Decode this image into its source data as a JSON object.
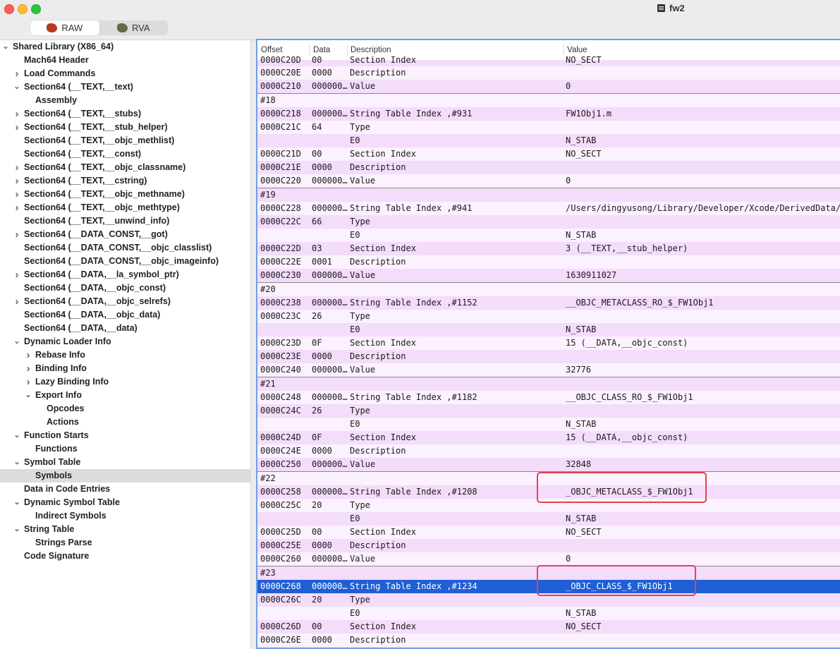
{
  "window": {
    "title": "fw2"
  },
  "toolbar": {
    "segments": [
      {
        "label": "RAW",
        "icon": "raw-icon",
        "active": true
      },
      {
        "label": "RVA",
        "icon": "rva-icon",
        "active": false
      }
    ]
  },
  "sidebar": {
    "items": [
      {
        "label": "Shared Library  (X86_64)",
        "level": 0,
        "chevron": "down"
      },
      {
        "label": "Mach64 Header",
        "level": 1,
        "chevron": ""
      },
      {
        "label": "Load Commands",
        "level": 1,
        "chevron": "right"
      },
      {
        "label": "Section64 (__TEXT,__text)",
        "level": 1,
        "chevron": "down"
      },
      {
        "label": "Assembly",
        "level": 2,
        "chevron": ""
      },
      {
        "label": "Section64 (__TEXT,__stubs)",
        "level": 1,
        "chevron": "right"
      },
      {
        "label": "Section64 (__TEXT,__stub_helper)",
        "level": 1,
        "chevron": "right"
      },
      {
        "label": "Section64 (__TEXT,__objc_methlist)",
        "level": 1,
        "chevron": ""
      },
      {
        "label": "Section64 (__TEXT,__const)",
        "level": 1,
        "chevron": ""
      },
      {
        "label": "Section64 (__TEXT,__objc_classname)",
        "level": 1,
        "chevron": "right"
      },
      {
        "label": "Section64 (__TEXT,__cstring)",
        "level": 1,
        "chevron": "right"
      },
      {
        "label": "Section64 (__TEXT,__objc_methname)",
        "level": 1,
        "chevron": "right"
      },
      {
        "label": "Section64 (__TEXT,__objc_methtype)",
        "level": 1,
        "chevron": "right"
      },
      {
        "label": "Section64 (__TEXT,__unwind_info)",
        "level": 1,
        "chevron": ""
      },
      {
        "label": "Section64 (__DATA_CONST,__got)",
        "level": 1,
        "chevron": "right"
      },
      {
        "label": "Section64 (__DATA_CONST,__objc_classlist)",
        "level": 1,
        "chevron": ""
      },
      {
        "label": "Section64 (__DATA_CONST,__objc_imageinfo)",
        "level": 1,
        "chevron": ""
      },
      {
        "label": "Section64 (__DATA,__la_symbol_ptr)",
        "level": 1,
        "chevron": "right"
      },
      {
        "label": "Section64 (__DATA,__objc_const)",
        "level": 1,
        "chevron": ""
      },
      {
        "label": "Section64 (__DATA,__objc_selrefs)",
        "level": 1,
        "chevron": "right"
      },
      {
        "label": "Section64 (__DATA,__objc_data)",
        "level": 1,
        "chevron": ""
      },
      {
        "label": "Section64 (__DATA,__data)",
        "level": 1,
        "chevron": ""
      },
      {
        "label": "Dynamic Loader Info",
        "level": 1,
        "chevron": "down"
      },
      {
        "label": "Rebase Info",
        "level": 2,
        "chevron": "right"
      },
      {
        "label": "Binding Info",
        "level": 2,
        "chevron": "right"
      },
      {
        "label": "Lazy Binding Info",
        "level": 2,
        "chevron": "right"
      },
      {
        "label": "Export Info",
        "level": 2,
        "chevron": "down"
      },
      {
        "label": "Opcodes",
        "level": 3,
        "chevron": ""
      },
      {
        "label": "Actions",
        "level": 3,
        "chevron": ""
      },
      {
        "label": "Function Starts",
        "level": 1,
        "chevron": "down"
      },
      {
        "label": "Functions",
        "level": 2,
        "chevron": ""
      },
      {
        "label": "Symbol Table",
        "level": 1,
        "chevron": "down"
      },
      {
        "label": "Symbols",
        "level": 2,
        "chevron": "",
        "selected": true
      },
      {
        "label": "Data in Code Entries",
        "level": 1,
        "chevron": ""
      },
      {
        "label": "Dynamic Symbol Table",
        "level": 1,
        "chevron": "down"
      },
      {
        "label": "Indirect Symbols",
        "level": 2,
        "chevron": ""
      },
      {
        "label": "String Table",
        "level": 1,
        "chevron": "down"
      },
      {
        "label": "Strings Parse",
        "level": 2,
        "chevron": ""
      },
      {
        "label": "Code Signature",
        "level": 1,
        "chevron": ""
      }
    ]
  },
  "table": {
    "columns": [
      "Offset",
      "Data",
      "Description",
      "Value"
    ],
    "rows": [
      {
        "offset": "0000C20D",
        "data": "00",
        "desc": "Section Index",
        "value": "NO_SECT",
        "partial": true
      },
      {
        "offset": "0000C20E",
        "data": "0000",
        "desc": "Description",
        "value": ""
      },
      {
        "offset": "0000C210",
        "data": "000000…",
        "desc": "Value",
        "value": "0"
      },
      {
        "offset": "#18",
        "data": "",
        "desc": "",
        "value": "",
        "group": true
      },
      {
        "offset": "0000C218",
        "data": "000000…",
        "desc": "String Table Index ,#931",
        "value": "FW1Obj1.m"
      },
      {
        "offset": "0000C21C",
        "data": "64",
        "desc": "Type",
        "value": ""
      },
      {
        "offset": "",
        "data": "",
        "desc": "E0",
        "value": "N_STAB"
      },
      {
        "offset": "0000C21D",
        "data": "00",
        "desc": "Section Index",
        "value": "NO_SECT"
      },
      {
        "offset": "0000C21E",
        "data": "0000",
        "desc": "Description",
        "value": ""
      },
      {
        "offset": "0000C220",
        "data": "000000…",
        "desc": "Value",
        "value": "0"
      },
      {
        "offset": "#19",
        "data": "",
        "desc": "",
        "value": "",
        "group": true
      },
      {
        "offset": "0000C228",
        "data": "000000…",
        "desc": "String Table Index ,#941",
        "value": "/Users/dingyusong/Library/Developer/Xcode/DerivedData/"
      },
      {
        "offset": "0000C22C",
        "data": "66",
        "desc": "Type",
        "value": ""
      },
      {
        "offset": "",
        "data": "",
        "desc": "E0",
        "value": "N_STAB"
      },
      {
        "offset": "0000C22D",
        "data": "03",
        "desc": "Section Index",
        "value": "3 (__TEXT,__stub_helper)"
      },
      {
        "offset": "0000C22E",
        "data": "0001",
        "desc": "Description",
        "value": ""
      },
      {
        "offset": "0000C230",
        "data": "000000…",
        "desc": "Value",
        "value": "1630911027"
      },
      {
        "offset": "#20",
        "data": "",
        "desc": "",
        "value": "",
        "group": true
      },
      {
        "offset": "0000C238",
        "data": "000000…",
        "desc": "String Table Index ,#1152",
        "value": "__OBJC_METACLASS_RO_$_FW1Obj1"
      },
      {
        "offset": "0000C23C",
        "data": "26",
        "desc": "Type",
        "value": ""
      },
      {
        "offset": "",
        "data": "",
        "desc": "E0",
        "value": "N_STAB"
      },
      {
        "offset": "0000C23D",
        "data": "0F",
        "desc": "Section Index",
        "value": "15 (__DATA,__objc_const)"
      },
      {
        "offset": "0000C23E",
        "data": "0000",
        "desc": "Description",
        "value": ""
      },
      {
        "offset": "0000C240",
        "data": "000000…",
        "desc": "Value",
        "value": "32776"
      },
      {
        "offset": "#21",
        "data": "",
        "desc": "",
        "value": "",
        "group": true
      },
      {
        "offset": "0000C248",
        "data": "000000…",
        "desc": "String Table Index ,#1182",
        "value": "__OBJC_CLASS_RO_$_FW1Obj1"
      },
      {
        "offset": "0000C24C",
        "data": "26",
        "desc": "Type",
        "value": ""
      },
      {
        "offset": "",
        "data": "",
        "desc": "E0",
        "value": "N_STAB"
      },
      {
        "offset": "0000C24D",
        "data": "0F",
        "desc": "Section Index",
        "value": "15 (__DATA,__objc_const)"
      },
      {
        "offset": "0000C24E",
        "data": "0000",
        "desc": "Description",
        "value": ""
      },
      {
        "offset": "0000C250",
        "data": "000000…",
        "desc": "Value",
        "value": "32848"
      },
      {
        "offset": "#22",
        "data": "",
        "desc": "",
        "value": "",
        "group": true
      },
      {
        "offset": "0000C258",
        "data": "000000…",
        "desc": "String Table Index ,#1208",
        "value": "_OBJC_METACLASS_$_FW1Obj1"
      },
      {
        "offset": "0000C25C",
        "data": "20",
        "desc": "Type",
        "value": ""
      },
      {
        "offset": "",
        "data": "",
        "desc": "E0",
        "value": "N_STAB"
      },
      {
        "offset": "0000C25D",
        "data": "00",
        "desc": "Section Index",
        "value": "NO_SECT"
      },
      {
        "offset": "0000C25E",
        "data": "0000",
        "desc": "Description",
        "value": ""
      },
      {
        "offset": "0000C260",
        "data": "000000…",
        "desc": "Value",
        "value": "0"
      },
      {
        "offset": "#23",
        "data": "",
        "desc": "",
        "value": "",
        "group": true
      },
      {
        "offset": "0000C268",
        "data": "000000…",
        "desc": "String Table Index ,#1234",
        "value": "_OBJC_CLASS_$_FW1Obj1",
        "selected": true
      },
      {
        "offset": "0000C26C",
        "data": "20",
        "desc": "Type",
        "value": ""
      },
      {
        "offset": "",
        "data": "",
        "desc": "E0",
        "value": "N_STAB"
      },
      {
        "offset": "0000C26D",
        "data": "00",
        "desc": "Section Index",
        "value": "NO_SECT"
      },
      {
        "offset": "0000C26E",
        "data": "0000",
        "desc": "Description",
        "value": ""
      },
      {
        "offset": "0000C270",
        "data": "000000…",
        "desc": "Value",
        "value": "0"
      }
    ]
  },
  "colors": {
    "row_even": "#fbf1ff",
    "row_odd": "#f4dcfb",
    "selection": "#1f5fd6",
    "annotation_box": "#e0454f"
  }
}
